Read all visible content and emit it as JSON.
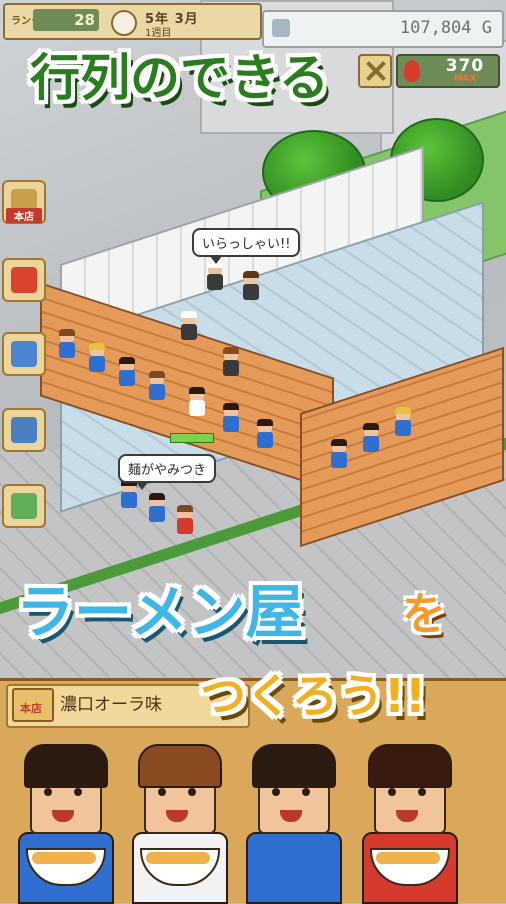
{
  "hud": {
    "rank_label": "ランク",
    "rank_value": "28",
    "date": "5年 3月",
    "date_sub": "1週目",
    "money": "107,804 G",
    "stamina_value": "370",
    "stamina_max": "MAX"
  },
  "side_menu": {
    "items": [
      {
        "label": "本店",
        "icon": "shop-sign-icon"
      },
      {
        "label": "",
        "icon": "staff-face-icon"
      },
      {
        "label": "",
        "icon": "menu-book-icon"
      },
      {
        "label": "",
        "icon": "pot-icon"
      },
      {
        "label": "",
        "icon": "bag-icon"
      }
    ]
  },
  "bubbles": {
    "greeting": "いらっしゃい!!",
    "review": "麺がやみつき"
  },
  "promo": {
    "top": "行列のできる",
    "middle": "ラーメン屋",
    "particle": "を",
    "bottom": "つくろう!!"
  },
  "panel": {
    "logo": "本店",
    "title": "濃口オーラ味"
  },
  "colors": {
    "title_green": "#2a7d1e",
    "title_blue": "#3fb6e6",
    "title_orange": "#f0b020",
    "stamina_max_red": "#ff6b3d"
  }
}
